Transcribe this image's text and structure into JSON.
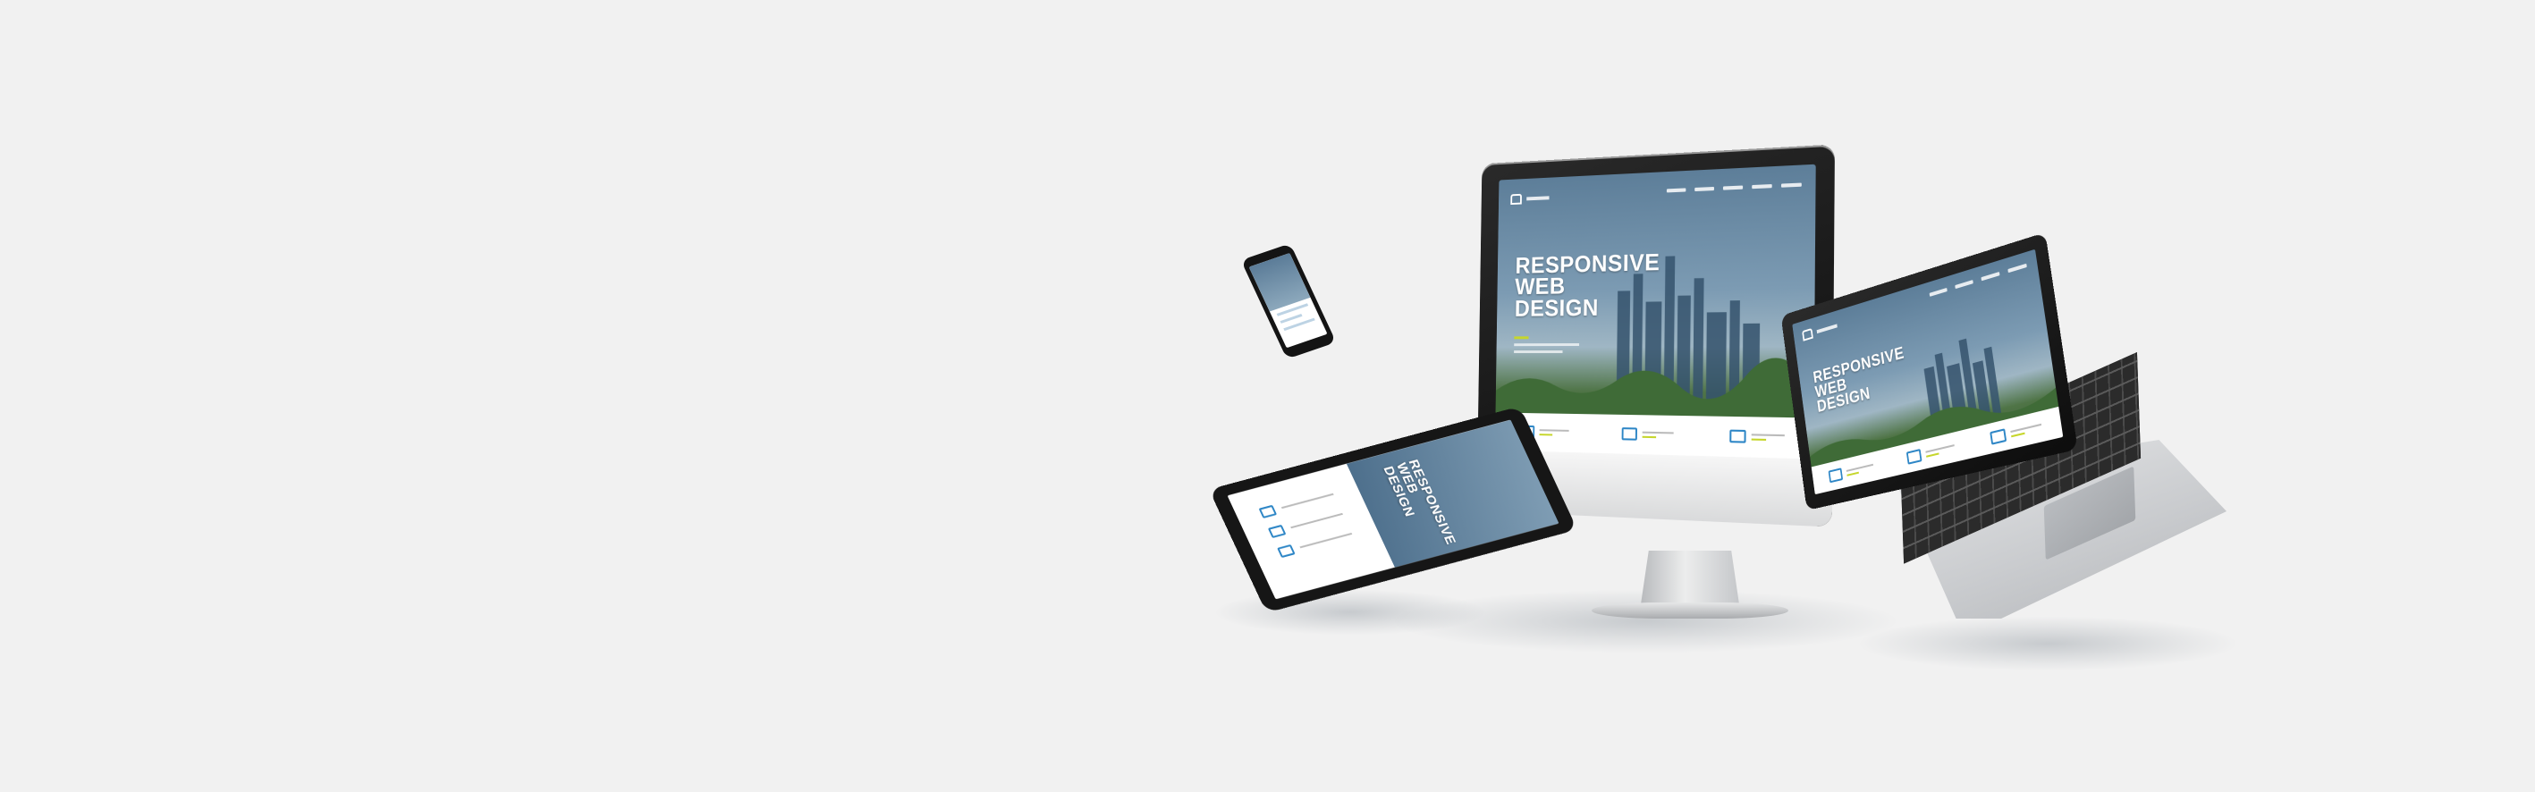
{
  "hero": {
    "line1": "RESPONSIVE",
    "line2": "WEB",
    "line3": "DESIGN"
  },
  "colors": {
    "background": "#f1f1f1",
    "accent_blue": "#2d86c6",
    "accent_lime": "#c6d62c",
    "device_black": "#141414"
  },
  "icons": {
    "home": "home-icon",
    "chart": "chart-icon",
    "mail": "mail-icon"
  }
}
